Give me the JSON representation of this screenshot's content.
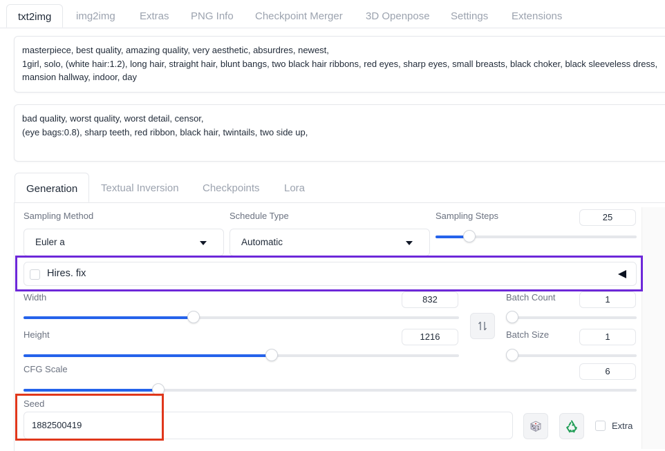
{
  "top_tabs": [
    "txt2img",
    "img2img",
    "Extras",
    "PNG Info",
    "Checkpoint Merger",
    "3D Openpose",
    "Settings",
    "Extensions"
  ],
  "prompt": {
    "lines": [
      "masterpiece, best quality, amazing quality, very aesthetic, absurdres, newest,",
      "1girl, solo, (white hair:1.2), long hair, straight hair, blunt bangs, two black hair ribbons, red eyes, sharp eyes, small breasts, black choker, black sleeveless dress,",
      "mansion hallway, indoor, day"
    ]
  },
  "negative_prompt": {
    "lines": [
      "bad quality, worst quality, worst detail, censor,",
      "(eye bags:0.8), sharp teeth, red ribbon, black hair, twintails, two side up,"
    ]
  },
  "sub_tabs": [
    "Generation",
    "Textual Inversion",
    "Checkpoints",
    "Lora"
  ],
  "generation": {
    "sampling_method": {
      "label": "Sampling Method",
      "value": "Euler a"
    },
    "schedule_type": {
      "label": "Schedule Type",
      "value": "Automatic"
    },
    "sampling_steps": {
      "label": "Sampling Steps",
      "value": "25",
      "fraction": 0.17
    },
    "hires_fix": {
      "label": "Hires. fix",
      "checked": false,
      "toggle_icon": "triangle-left-icon"
    },
    "width": {
      "label": "Width",
      "value": "832",
      "fraction": 0.39
    },
    "height": {
      "label": "Height",
      "value": "1216",
      "fraction": 0.57
    },
    "swap_icon": "swap-vertical-icon",
    "batch_count": {
      "label": "Batch Count",
      "value": "1",
      "fraction": 0.0
    },
    "batch_size": {
      "label": "Batch Size",
      "value": "1",
      "fraction": 0.0
    },
    "cfg_scale": {
      "label": "CFG Scale",
      "value": "6",
      "fraction": 0.22
    },
    "seed": {
      "label": "Seed",
      "value": "1882500419"
    },
    "dice_icon": "dice-icon",
    "recycle_icon": "recycle-icon",
    "extra": {
      "label": "Extra",
      "checked": false
    }
  },
  "colors": {
    "accent": "#2563eb",
    "highlight_purple": "#6d28d9",
    "highlight_red": "#e0371b"
  }
}
